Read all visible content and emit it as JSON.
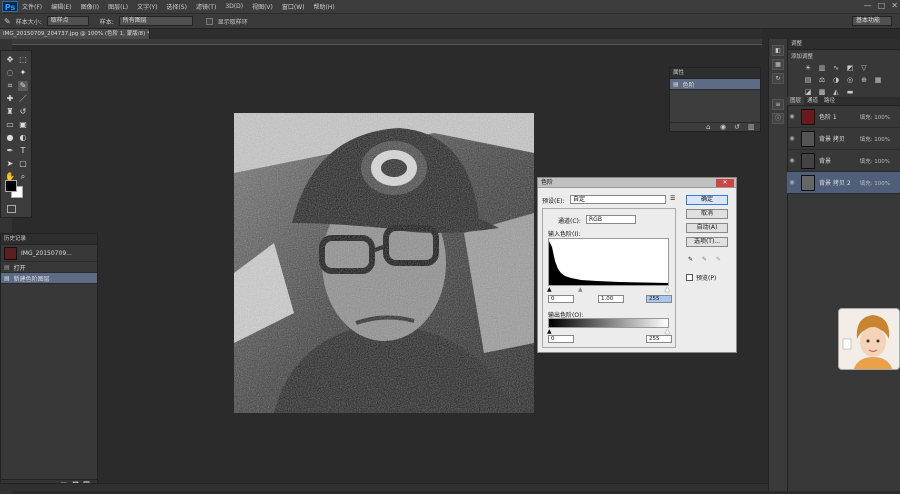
{
  "app": {
    "logo": "Ps"
  },
  "menu": {
    "items": [
      "文件(F)",
      "编辑(E)",
      "图像(I)",
      "图层(L)",
      "文字(Y)",
      "选择(S)",
      "滤镜(T)",
      "3D(D)",
      "视图(V)",
      "窗口(W)",
      "帮助(H)"
    ]
  },
  "window_controls": {
    "minimize": "—",
    "maximize": "□",
    "close": "✕"
  },
  "options_bar": {
    "size_label": "样本大小:",
    "size_value": "取样点",
    "sample_label": "样本:",
    "sample_value": "所有图层",
    "show_ring_label": "显示取样环",
    "workspace": "基本功能"
  },
  "document": {
    "tab_title": "IMG_20150709_204737.jpg @ 100% (色阶 1, 蒙版/8) *",
    "tab_close": "×"
  },
  "history_panel": {
    "title": "历史记录",
    "snapshot_label": "IMG_20150709...",
    "items": [
      {
        "label": "打开"
      },
      {
        "label": "新建色阶图层"
      }
    ]
  },
  "small_panel": {
    "title": "属性",
    "item": "色阶"
  },
  "adjustments_panel": {
    "title": "调整",
    "subtitle": "添加调整"
  },
  "layers": {
    "tabs": [
      "图层",
      "通道",
      "路径"
    ],
    "rows": [
      {
        "label": "色阶 1",
        "opacity": "填充: 100%"
      },
      {
        "label": "背景 拷贝",
        "opacity": "填充: 100%"
      },
      {
        "label": "背景",
        "opacity": "填充: 100%"
      },
      {
        "label": "背景 拷贝 2",
        "opacity": "填充: 100%"
      }
    ]
  },
  "levels_dialog": {
    "title": "色阶",
    "close": "✕",
    "preset_label": "预设(E):",
    "preset_value": "自定",
    "channel_label": "通道(C):",
    "channel_value": "RGB",
    "input_label": "输入色阶(I):",
    "input_values": [
      "0",
      "1.00",
      "255"
    ],
    "output_label": "输出色阶(O):",
    "output_values": [
      "0",
      "255"
    ],
    "buttons": {
      "ok": "确定",
      "cancel": "取消",
      "auto": "自动(A)",
      "options": "选项(T)..."
    },
    "preview_label": "预览(P)"
  }
}
